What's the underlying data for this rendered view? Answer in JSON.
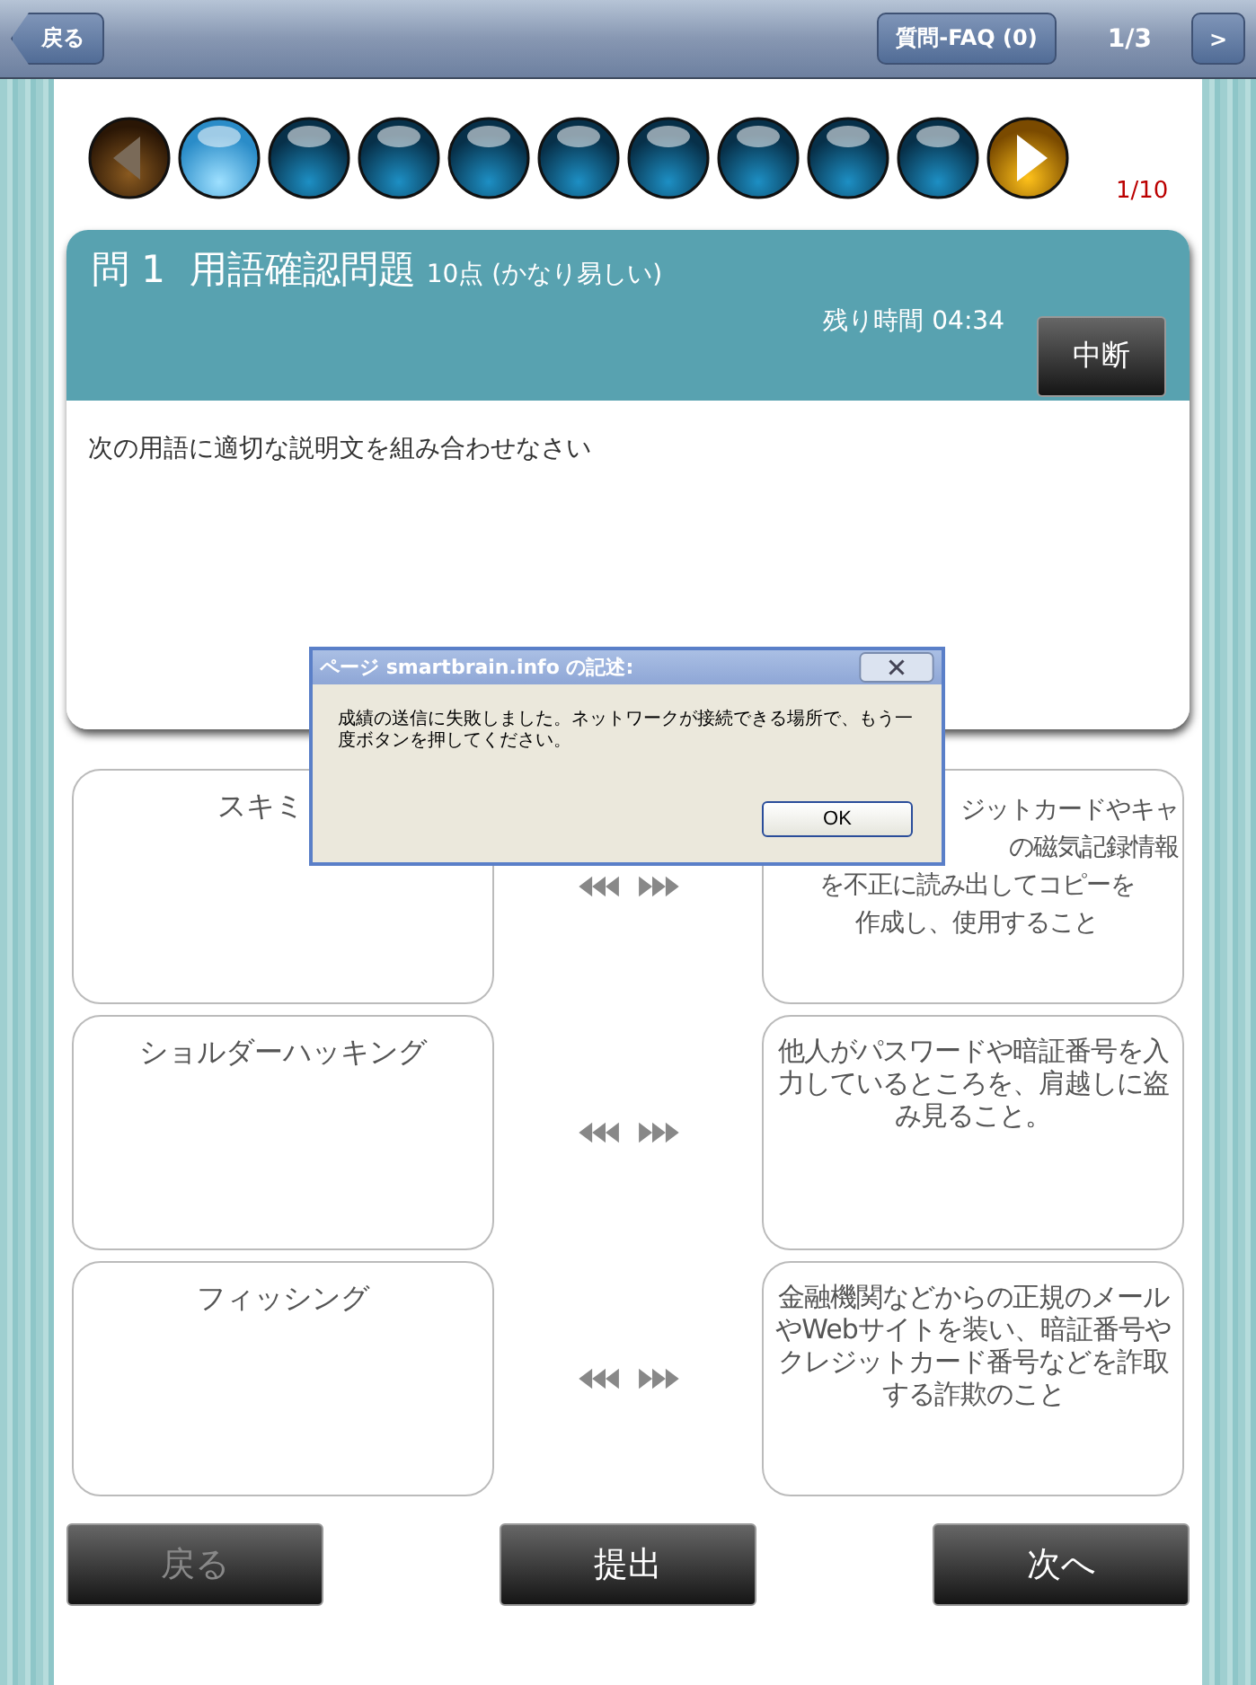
{
  "nav_bar": {
    "back": "戻る",
    "faq": "質問-FAQ (0)",
    "page": "1/3",
    "next": ">"
  },
  "question_dots": [
    {
      "selected": true
    },
    {
      "selected": false
    },
    {
      "selected": false
    },
    {
      "selected": false
    },
    {
      "selected": false
    },
    {
      "selected": false
    },
    {
      "selected": false
    },
    {
      "selected": false
    },
    {
      "selected": false
    }
  ],
  "progress": "1/10",
  "question": {
    "number": "問 1",
    "title": "用語確認問題",
    "points": "10点 (かなり易しい)",
    "timer": "残り時間 04:34",
    "pause": "中断",
    "instruction": "次の用語に適切な説明文を組み合わせなさい"
  },
  "pairs": [
    {
      "term": "スキミ",
      "covered": true,
      "description": [
        "ジットカードやキャ",
        "の磁気記録情報",
        "を不正に読み出してコピーを",
        "作成し、使用すること"
      ]
    },
    {
      "term": "ショルダーハッキング",
      "covered": false,
      "description": [
        "他人がパスワードや暗証番号を入力しているところを、肩越しに盗み見ること。"
      ]
    },
    {
      "term": "フィッシング",
      "covered": false,
      "description": [
        "金融機関などからの正規のメールやWebサイトを装い、暗証番号やクレジットカード番号などを詐取する詐欺のこと"
      ]
    }
  ],
  "buttons": [
    {
      "label": "戻る",
      "disabled": true
    },
    {
      "label": "提出",
      "disabled": false
    },
    {
      "label": "次へ",
      "disabled": false
    }
  ],
  "dialog": {
    "title": "ページ smartbrain.info の記述:",
    "message": "成績の送信に失敗しました。ネットワークが接続できる場所で、もう一度ボタンを押してください。",
    "ok": "OK"
  }
}
